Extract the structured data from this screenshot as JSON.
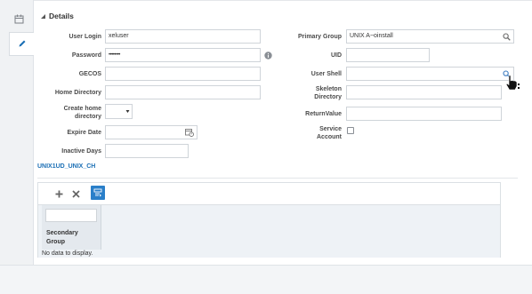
{
  "section": {
    "title": "Details"
  },
  "fields": {
    "user_login": {
      "label": "User Login",
      "value": "xeluser"
    },
    "password": {
      "label": "Password",
      "value": "••••••••"
    },
    "gecos": {
      "label": "GECOS",
      "value": ""
    },
    "home_directory": {
      "label": "Home Directory",
      "value": ""
    },
    "create_home_directory": {
      "label_line1": "Create home",
      "label_line2": "directory",
      "value": ""
    },
    "expire_date": {
      "label": "Expire Date",
      "value": ""
    },
    "inactive_days": {
      "label": "Inactive Days",
      "value": ""
    },
    "primary_group": {
      "label": "Primary Group",
      "value": "UNIX A~oinstall"
    },
    "uid": {
      "label": "UID",
      "value": ""
    },
    "user_shell": {
      "label": "User Shell",
      "value": ""
    },
    "skeleton_directory": {
      "label_line1": "Skeleton",
      "label_line2": "Directory",
      "value": ""
    },
    "return_value": {
      "label": "ReturnValue",
      "value": ""
    },
    "service_account": {
      "label_line1": "Service",
      "label_line2": "Account",
      "checked": false
    }
  },
  "link_text": "UNIX1UD_UNIX_CH",
  "table": {
    "column_title_line1": "Secondary",
    "column_title_line2": "Group",
    "empty_text": "No data to display."
  },
  "icons": {
    "calendar_tab": "calendar-icon",
    "edit_tab": "pencil-icon",
    "info": "info-icon",
    "search": "search-icon",
    "date_picker": "calendar-clock-icon",
    "add": "plus-icon",
    "remove": "x-icon",
    "export": "detach-icon"
  },
  "colors": {
    "accent": "#1b6fb5",
    "toolbar_active": "#2a7fc9"
  }
}
